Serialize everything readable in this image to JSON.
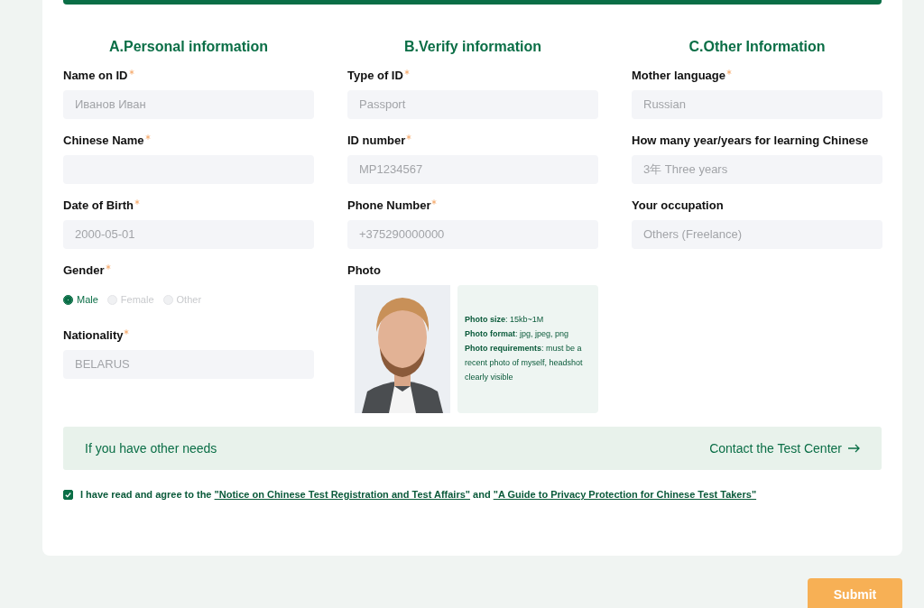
{
  "sections": [
    {
      "title": "A.Personal information",
      "fields": [
        {
          "kind": "text",
          "label": "Name on ID",
          "required": true,
          "value": "Иванов Иван"
        },
        {
          "kind": "text",
          "label": "Chinese Name",
          "required": true
        },
        {
          "kind": "text",
          "label": "Date of Birth",
          "required": true,
          "value": "2000-05-01"
        },
        {
          "kind": "radio",
          "label": "Gender",
          "required": true,
          "options": [
            {
              "label": "Male",
              "selected": true
            },
            {
              "label": "Female",
              "selected": false
            },
            {
              "label": "Other",
              "selected": false
            }
          ]
        },
        {
          "kind": "text",
          "label": "Nationality",
          "required": true,
          "value": "BELARUS"
        }
      ]
    },
    {
      "title": "B.Verify information",
      "fields": [
        {
          "kind": "text",
          "label": "Type of ID",
          "required": true,
          "value": "Passport"
        },
        {
          "kind": "text",
          "label": "ID number",
          "required": true,
          "value": "MP1234567"
        },
        {
          "kind": "text",
          "label": "Phone Number",
          "required": true,
          "value": "+375290000000"
        },
        {
          "label": "Photo",
          "required": false,
          "notes": [
            "**Photo size**: 15kb~1M",
            "**Photo format**: jpg, jpeg, png",
            "**Photo requirements**: must be a recent photo of myself, headshot clearly visible"
          ]
        }
      ]
    },
    {
      "title": "C.Other Information",
      "fields": [
        {
          "kind": "text",
          "label": "Mother language",
          "required": true,
          "value": "Russian"
        },
        {
          "kind": "text",
          "label": "How many year/years for learning Chinese",
          "required": false,
          "value": "3年 Three years"
        },
        {
          "kind": "text",
          "label": "Your occupation",
          "required": false,
          "value": "Others (Freelance)"
        }
      ]
    }
  ],
  "notice": {
    "text": "If you have other needs",
    "link": "Contact the Test Center"
  },
  "agreement": {
    "checked": true,
    "parts": [
      {
        "kind": "text",
        "text": "I have read and agree to the "
      },
      {
        "kind": "link",
        "text": "\"Notice on Chinese Test Registration and Test Affairs\""
      },
      {
        "kind": "text",
        "text": " and "
      },
      {
        "kind": "link",
        "text": "\"A Guide to Privacy Protection for Chinese Test Takers\""
      }
    ]
  },
  "submit": "Submit"
}
